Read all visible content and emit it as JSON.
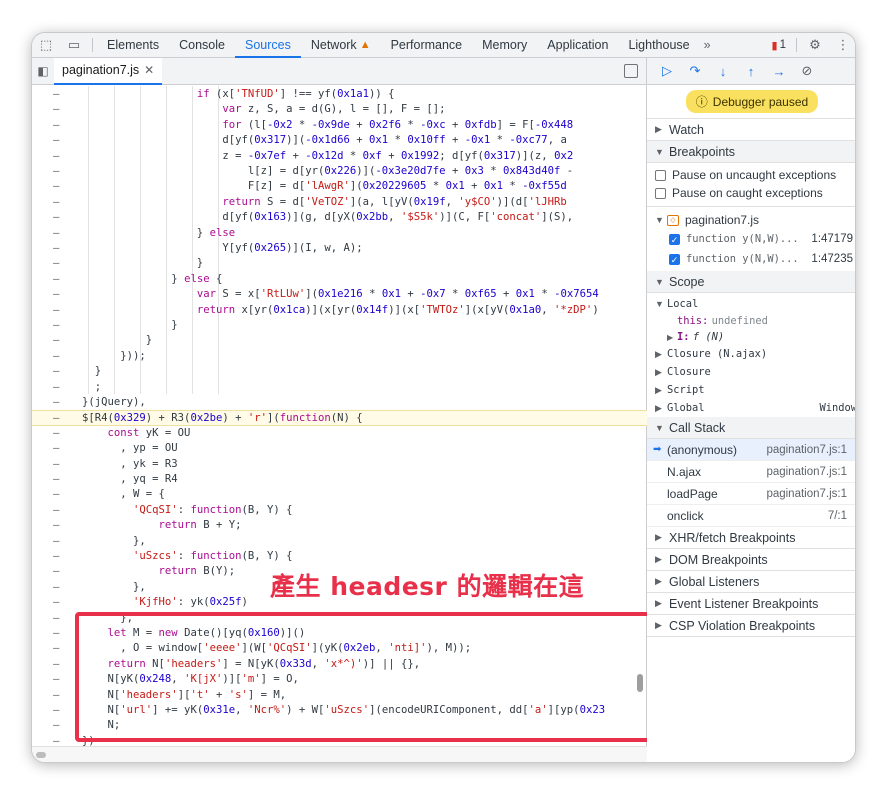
{
  "topbar": {
    "tabs": [
      "Elements",
      "Console",
      "Sources",
      "Network",
      "Performance",
      "Memory",
      "Application",
      "Lighthouse"
    ],
    "active_tab": "Sources",
    "more_label": "»",
    "issues_count": "1"
  },
  "editor": {
    "file_tab": "pagination7.js",
    "lines": [
      {
        "t": [
          [
            "                  ",
            ""
          ],
          [
            "if",
            "k"
          ],
          [
            " (x[",
            ""
          ],
          [
            "'TNfUD'",
            "s"
          ],
          [
            "] !== yf(",
            ""
          ],
          [
            "0x1a1",
            "n"
          ],
          [
            ")) {",
            ""
          ]
        ]
      },
      {
        "t": [
          [
            "                      ",
            ""
          ],
          [
            "var",
            "k"
          ],
          [
            " z, S, a = d(G), l = [], F = [];",
            ""
          ]
        ]
      },
      {
        "t": [
          [
            "                      ",
            ""
          ],
          [
            "for",
            "k"
          ],
          [
            " (l[",
            ""
          ],
          [
            "-0x2",
            "n"
          ],
          [
            " * ",
            ""
          ],
          [
            "-0x9de",
            "n"
          ],
          [
            " + ",
            ""
          ],
          [
            "0x2f6",
            "n"
          ],
          [
            " * ",
            ""
          ],
          [
            "-0xc",
            "n"
          ],
          [
            " + ",
            ""
          ],
          [
            "0xfdb",
            "n"
          ],
          [
            "] = F[",
            ""
          ],
          [
            "-0x448",
            "n"
          ]
        ]
      },
      {
        "t": [
          [
            "                      d[yf(",
            ""
          ],
          [
            "0x317",
            "n"
          ],
          [
            ")](",
            ""
          ],
          [
            "-0x1d66",
            "n"
          ],
          [
            " + ",
            ""
          ],
          [
            "0x1",
            "n"
          ],
          [
            " * ",
            ""
          ],
          [
            "0x10ff",
            "n"
          ],
          [
            " + ",
            ""
          ],
          [
            "-0x1",
            "n"
          ],
          [
            " * ",
            ""
          ],
          [
            "-0xc77",
            "n"
          ],
          [
            ", a",
            ""
          ]
        ]
      },
      {
        "t": [
          [
            "                      z = ",
            ""
          ],
          [
            "-0x7ef",
            "n"
          ],
          [
            " + ",
            ""
          ],
          [
            "-0x12d",
            "n"
          ],
          [
            " * ",
            ""
          ],
          [
            "0xf",
            "n"
          ],
          [
            " + ",
            ""
          ],
          [
            "0x1992",
            "n"
          ],
          [
            "; d[yf(",
            ""
          ],
          [
            "0x317",
            "n"
          ],
          [
            ")](z, ",
            ""
          ],
          [
            "0x2",
            "n"
          ]
        ]
      },
      {
        "t": [
          [
            "                          l[z] = d[yr(",
            ""
          ],
          [
            "0x226",
            "n"
          ],
          [
            ")](",
            ""
          ],
          [
            "-0x3e20d7fe",
            "n"
          ],
          [
            " + ",
            ""
          ],
          [
            "0x3",
            "n"
          ],
          [
            " * ",
            ""
          ],
          [
            "0x843d40f",
            "n"
          ],
          [
            " -",
            ""
          ]
        ]
      },
      {
        "t": [
          [
            "                          F[z] = d[",
            ""
          ],
          [
            "'lAwgR'",
            "s"
          ],
          [
            "](",
            ""
          ],
          [
            "0x20229605",
            "n"
          ],
          [
            " * ",
            ""
          ],
          [
            "0x1",
            "n"
          ],
          [
            " + ",
            ""
          ],
          [
            "0x1",
            "n"
          ],
          [
            " * ",
            ""
          ],
          [
            "-0xf55d",
            "n"
          ]
        ]
      },
      {
        "t": [
          [
            "                      ",
            ""
          ],
          [
            "return",
            "k"
          ],
          [
            " S = d[",
            ""
          ],
          [
            "'VeTOZ'",
            "s"
          ],
          [
            "](a, l[yV(",
            ""
          ],
          [
            "0x19f",
            "n"
          ],
          [
            ", ",
            ""
          ],
          [
            "'y$CO'",
            "s"
          ],
          [
            ")](d[",
            ""
          ],
          [
            "'lJHRb",
            "s"
          ]
        ]
      },
      {
        "t": [
          [
            "                      d[yf(",
            ""
          ],
          [
            "0x163",
            "n"
          ],
          [
            ")](g, d[yX(",
            ""
          ],
          [
            "0x2bb",
            "n"
          ],
          [
            ", ",
            ""
          ],
          [
            "'$S5k'",
            "s"
          ],
          [
            ")](C, F[",
            ""
          ],
          [
            "'concat'",
            "s"
          ],
          [
            "](S),",
            ""
          ]
        ]
      },
      {
        "t": [
          [
            "                  } ",
            ""
          ],
          [
            "else",
            "k"
          ]
        ]
      },
      {
        "t": [
          [
            "                      Y[yf(",
            ""
          ],
          [
            "0x265",
            "n"
          ],
          [
            ")](I, w, A);",
            ""
          ]
        ]
      },
      {
        "t": [
          [
            "                  }",
            ""
          ]
        ]
      },
      {
        "t": [
          [
            "              } ",
            ""
          ],
          [
            "else",
            "k"
          ],
          [
            " {",
            ""
          ]
        ]
      },
      {
        "t": [
          [
            "                  ",
            ""
          ],
          [
            "var",
            "k"
          ],
          [
            " S = x[",
            ""
          ],
          [
            "'RtLUw'",
            "s"
          ],
          [
            "](",
            ""
          ],
          [
            "0x1e216",
            "n"
          ],
          [
            " * ",
            ""
          ],
          [
            "0x1",
            "n"
          ],
          [
            " + ",
            ""
          ],
          [
            "-0x7",
            "n"
          ],
          [
            " * ",
            ""
          ],
          [
            "0xf65",
            "n"
          ],
          [
            " + ",
            ""
          ],
          [
            "0x1",
            "n"
          ],
          [
            " * ",
            ""
          ],
          [
            "-0x7654",
            "n"
          ]
        ]
      },
      {
        "t": [
          [
            "                  ",
            ""
          ],
          [
            "return",
            "k"
          ],
          [
            " x[yr(",
            ""
          ],
          [
            "0x1ca",
            "n"
          ],
          [
            ")](x[yr(",
            ""
          ],
          [
            "0x14f",
            "n"
          ],
          [
            ")](x[",
            ""
          ],
          [
            "'TWTOz'",
            "s"
          ],
          [
            "](x[yV(",
            ""
          ],
          [
            "0x1a0",
            "n"
          ],
          [
            ", ",
            ""
          ],
          [
            "'*zDP'",
            "s"
          ],
          [
            ")",
            ""
          ]
        ]
      },
      {
        "t": [
          [
            "              }",
            ""
          ]
        ]
      },
      {
        "t": [
          [
            "          }",
            ""
          ]
        ]
      },
      {
        "t": [
          [
            "      }));",
            ""
          ]
        ]
      },
      {
        "t": [
          [
            "  }",
            ""
          ]
        ]
      },
      {
        "t": [
          [
            "  ;",
            ""
          ]
        ]
      },
      {
        "t": [
          [
            "}(jQuery),",
            ""
          ]
        ]
      },
      {
        "t": [
          [
            "$[R4(",
            ""
          ],
          [
            "0x329",
            "n"
          ],
          [
            ") + R3(",
            ""
          ],
          [
            "0x2be",
            "n"
          ],
          [
            ") + ",
            ""
          ],
          [
            "'r'",
            "s"
          ],
          [
            "](",
            ""
          ],
          [
            "function",
            "k"
          ],
          [
            "(N) {",
            ""
          ]
        ]
      },
      {
        "t": [
          [
            "    ",
            ""
          ],
          [
            "const",
            "k"
          ],
          [
            " yK = OU",
            ""
          ]
        ]
      },
      {
        "t": [
          [
            "      , yp = OU",
            ""
          ]
        ]
      },
      {
        "t": [
          [
            "      , yk = R3",
            ""
          ]
        ]
      },
      {
        "t": [
          [
            "      , yq = R4",
            ""
          ]
        ]
      },
      {
        "t": [
          [
            "      , W = {",
            ""
          ]
        ]
      },
      {
        "t": [
          [
            "        ",
            ""
          ],
          [
            "'QCqSI'",
            "s"
          ],
          [
            ": ",
            ""
          ],
          [
            "function",
            "k"
          ],
          [
            "(B, Y) {",
            ""
          ]
        ]
      },
      {
        "t": [
          [
            "            ",
            ""
          ],
          [
            "return",
            "k"
          ],
          [
            " B + Y;",
            ""
          ]
        ]
      },
      {
        "t": [
          [
            "        },",
            ""
          ]
        ]
      },
      {
        "t": [
          [
            "        ",
            ""
          ],
          [
            "'uSzcs'",
            "s"
          ],
          [
            ": ",
            ""
          ],
          [
            "function",
            "k"
          ],
          [
            "(B, Y) {",
            ""
          ]
        ]
      },
      {
        "t": [
          [
            "            ",
            ""
          ],
          [
            "return",
            "k"
          ],
          [
            " B(Y);",
            ""
          ]
        ]
      },
      {
        "t": [
          [
            "        },",
            ""
          ]
        ]
      },
      {
        "t": [
          [
            "        ",
            ""
          ],
          [
            "'KjfHo'",
            "s"
          ],
          [
            ": yk(",
            ""
          ],
          [
            "0x25f",
            "n"
          ],
          [
            ")",
            ""
          ]
        ]
      },
      {
        "t": [
          [
            "      },",
            ""
          ]
        ]
      },
      {
        "t": [
          [
            "    ",
            ""
          ],
          [
            "let",
            "k"
          ],
          [
            " M = ",
            ""
          ],
          [
            "new",
            "k"
          ],
          [
            " Date()[yq(",
            ""
          ],
          [
            "0x160",
            "n"
          ],
          [
            ")]()",
            ""
          ]
        ]
      },
      {
        "t": [
          [
            "      , O = window[",
            ""
          ],
          [
            "'eeee'",
            "s"
          ],
          [
            "](W[",
            ""
          ],
          [
            "'QCqSI'",
            "s"
          ],
          [
            "](yK(",
            ""
          ],
          [
            "0x2eb",
            "n"
          ],
          [
            ", ",
            ""
          ],
          [
            "'nti]'",
            "s"
          ],
          [
            "), M));",
            ""
          ]
        ]
      },
      {
        "t": [
          [
            "    ",
            ""
          ],
          [
            "return",
            "k"
          ],
          [
            " N[",
            ""
          ],
          [
            "'headers'",
            "s"
          ],
          [
            "] = N[yK(",
            ""
          ],
          [
            "0x33d",
            "n"
          ],
          [
            ", ",
            ""
          ],
          [
            "'x*^)'",
            "s"
          ],
          [
            ")] || {},",
            ""
          ]
        ]
      },
      {
        "t": [
          [
            "    N[yK(",
            ""
          ],
          [
            "0x248",
            "n"
          ],
          [
            ", ",
            ""
          ],
          [
            "'K[jX'",
            "s"
          ],
          [
            ")][",
            ""
          ],
          [
            "'m'",
            "s"
          ],
          [
            "] = O,",
            ""
          ]
        ]
      },
      {
        "t": [
          [
            "    N[",
            ""
          ],
          [
            "'headers'",
            "s"
          ],
          [
            "][",
            ""
          ],
          [
            "'t'",
            "s"
          ],
          [
            " + ",
            ""
          ],
          [
            "'s'",
            "s"
          ],
          [
            "] = M,",
            ""
          ]
        ]
      },
      {
        "t": [
          [
            "    N[",
            ""
          ],
          [
            "'url'",
            "s"
          ],
          [
            "] += yK(",
            ""
          ],
          [
            "0x31e",
            "n"
          ],
          [
            ", ",
            ""
          ],
          [
            "'Ncr%'",
            "s"
          ],
          [
            ") + W[",
            ""
          ],
          [
            "'uSzcs'",
            "s"
          ],
          [
            "](encodeURIComponent, dd[",
            ""
          ],
          [
            "'a'",
            "s"
          ],
          [
            "][yp(",
            ""
          ],
          [
            "0x23",
            "n"
          ]
        ]
      },
      {
        "t": [
          [
            "    N;",
            ""
          ]
        ]
      },
      {
        "t": [
          [
            "})",
            ""
          ]
        ]
      }
    ],
    "gutter_mark": "–",
    "annotation": "產生 headesr 的邏輯在這"
  },
  "debugger": {
    "paused_label": "Debugger paused",
    "watch": "Watch",
    "breakpoints": "Breakpoints",
    "pause_uncaught": "Pause on uncaught exceptions",
    "pause_caught": "Pause on caught exceptions",
    "bp_file": "pagination7.js",
    "bp_items": [
      {
        "code": "function y(N,W)...",
        "loc": "1:47179"
      },
      {
        "code": "function y(N,W)...",
        "loc": "1:47235"
      }
    ],
    "scope": "Scope",
    "local": "Local",
    "this_key": "this:",
    "this_val": "undefined",
    "i_key": "I:",
    "i_val": "f (N)",
    "closure_ajax": "Closure (N.ajax)",
    "closure": "Closure",
    "script": "Script",
    "global": "Global",
    "global_val": "Window",
    "call_stack": "Call Stack",
    "frames": [
      {
        "name": "(anonymous)",
        "loc": "pagination7.js:1"
      },
      {
        "name": "N.ajax",
        "loc": "pagination7.js:1"
      },
      {
        "name": "loadPage",
        "loc": "pagination7.js:1"
      },
      {
        "name": "onclick",
        "loc": "7/:1"
      }
    ],
    "xhr": "XHR/fetch Breakpoints",
    "dom": "DOM Breakpoints",
    "global_listeners": "Global Listeners",
    "event_listener": "Event Listener Breakpoints",
    "csp": "CSP Violation Breakpoints"
  }
}
